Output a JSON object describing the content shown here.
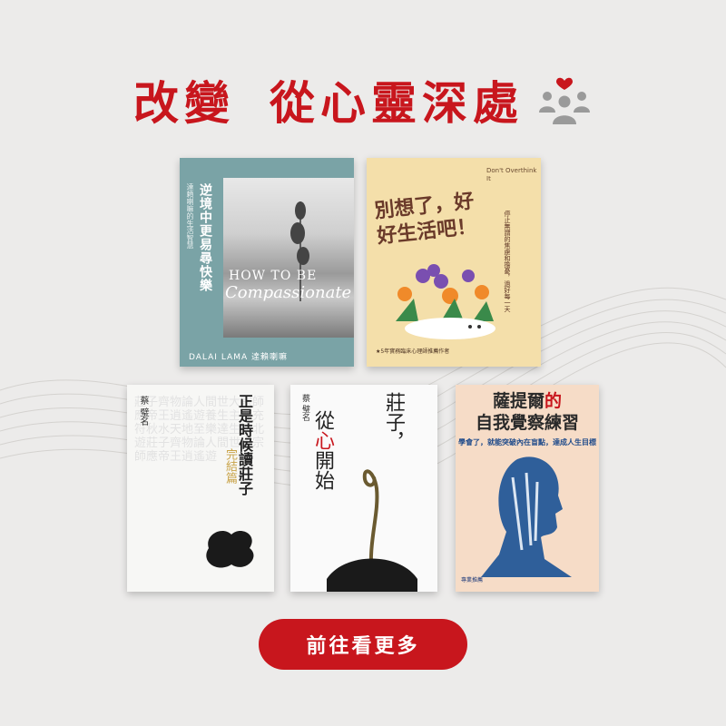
{
  "headline": {
    "part1": "改變",
    "part2": "從心靈深處",
    "icon": "people-heart-icon"
  },
  "books": [
    {
      "title": "逆境中更易尋快樂",
      "subtitle": "達賴喇嘛的生活智慧",
      "english_1": "HOW TO BE",
      "english_2": "Compassionate",
      "author": "DALAI LAMA 達賴喇嘛"
    },
    {
      "title": "別想了，好好生活吧！",
      "english": "Don't Overthink It",
      "side_text": "停止無謂的焦慮和擔憂，過好每一天",
      "footer": "★5年實務臨床心理師推薦作者"
    },
    {
      "title": "正是時候讀莊子",
      "subtitle": "完結篇",
      "author": "蔡 璧名",
      "bg_text": "莊子齊物論人間世大宗師應帝王逍遙遊養生主德充符秋水天地至樂達生知北遊莊子齊物論人間世大宗師應帝王逍遙遊"
    },
    {
      "title": "莊子，",
      "title_2a": "從",
      "title_2b": "心",
      "title_2c": "開始",
      "author": "蔡 璧名"
    },
    {
      "title_a": "薩提爾",
      "title_b": "的",
      "title_c": "自我覺察練習",
      "subtitle": "學會了，就能突破內在盲點，達成人生目標",
      "footer": "專業推薦"
    }
  ],
  "cta": {
    "label": "前往看更多"
  },
  "colors": {
    "brand_red": "#c8161d",
    "background": "#ecebea"
  }
}
